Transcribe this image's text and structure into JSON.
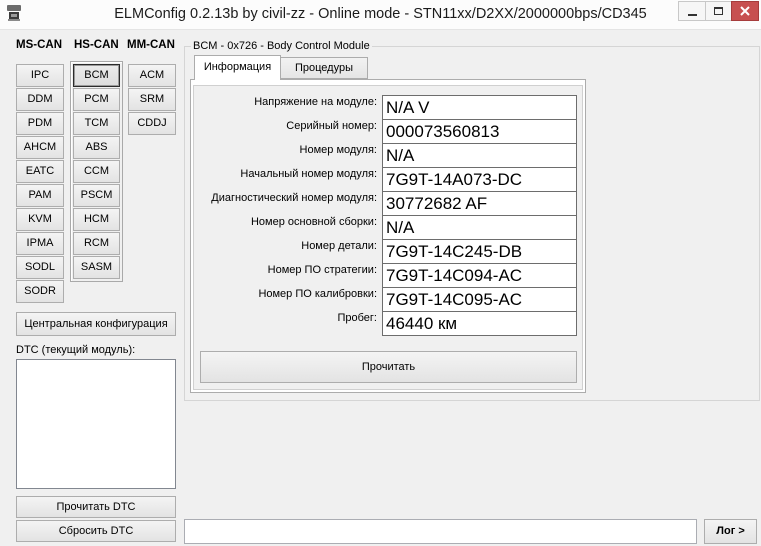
{
  "window": {
    "title": "ELMConfig 0.2.13b by civil-zz - Online mode - STN11xx/D2XX/2000000bps/CD345",
    "icons": {
      "app": "elm-app-icon",
      "minimize": "minimize-icon",
      "maximize": "maximize-icon",
      "close": "close-icon"
    }
  },
  "buses": [
    {
      "name": "MS-CAN",
      "active": false,
      "modules": [
        {
          "label": "IPC",
          "selected": false
        },
        {
          "label": "DDM",
          "selected": false
        },
        {
          "label": "PDM",
          "selected": false
        },
        {
          "label": "AHCM",
          "selected": false
        },
        {
          "label": "EATC",
          "selected": false
        },
        {
          "label": "PAM",
          "selected": false
        },
        {
          "label": "KVM",
          "selected": false
        },
        {
          "label": "IPMA",
          "selected": false
        },
        {
          "label": "SODL",
          "selected": false
        },
        {
          "label": "SODR",
          "selected": false
        }
      ]
    },
    {
      "name": "HS-CAN",
      "active": true,
      "modules": [
        {
          "label": "BCM",
          "selected": true
        },
        {
          "label": "PCM",
          "selected": false
        },
        {
          "label": "TCM",
          "selected": false
        },
        {
          "label": "ABS",
          "selected": false
        },
        {
          "label": "CCM",
          "selected": false
        },
        {
          "label": "PSCM",
          "selected": false
        },
        {
          "label": "HCM",
          "selected": false
        },
        {
          "label": "RCM",
          "selected": false
        },
        {
          "label": "SASM",
          "selected": false
        }
      ]
    },
    {
      "name": "MM-CAN",
      "active": false,
      "modules": [
        {
          "label": "ACM",
          "selected": false
        },
        {
          "label": "SRM",
          "selected": false
        },
        {
          "label": "CDDJ",
          "selected": false
        }
      ]
    }
  ],
  "central_config_button": "Центральная конфигурация",
  "dtc": {
    "label": "DTC (текущий модуль):",
    "items": [],
    "read_button": "Прочитать DTC",
    "clear_button": "Сбросить DTC"
  },
  "module_panel": {
    "title": "BCM - 0x726 - Body Control Module",
    "tabs": [
      {
        "label": "Информация",
        "active": true
      },
      {
        "label": "Процедуры",
        "active": false
      }
    ],
    "fields": [
      {
        "label": "Напряжение на модуле:",
        "value": "N/A V"
      },
      {
        "label": "Серийный номер:",
        "value": "000073560813"
      },
      {
        "label": "Номер модуля:",
        "value": "N/A"
      },
      {
        "label": "Начальный номер модуля:",
        "value": "7G9T-14A073-DC"
      },
      {
        "label": "Диагностический номер модуля:",
        "value": "30772682 AF"
      },
      {
        "label": "Номер основной сборки:",
        "value": "N/A"
      },
      {
        "label": "Номер детали:",
        "value": "7G9T-14C245-DB"
      },
      {
        "label": "Номер ПО стратегии:",
        "value": "7G9T-14C094-AC"
      },
      {
        "label": "Номер ПО калибровки:",
        "value": "7G9T-14C095-AC"
      },
      {
        "label": "Пробег:",
        "value": "46440 км"
      }
    ],
    "read_button": "Прочитать"
  },
  "log": {
    "input_value": "",
    "toggle_button": "Лог >"
  },
  "colors": {
    "window_bg": "#f0f0f0",
    "value_box_bg": "#ffffff",
    "close_button_bg": "#c75050",
    "selected_module_border": "#2b2b2b"
  }
}
